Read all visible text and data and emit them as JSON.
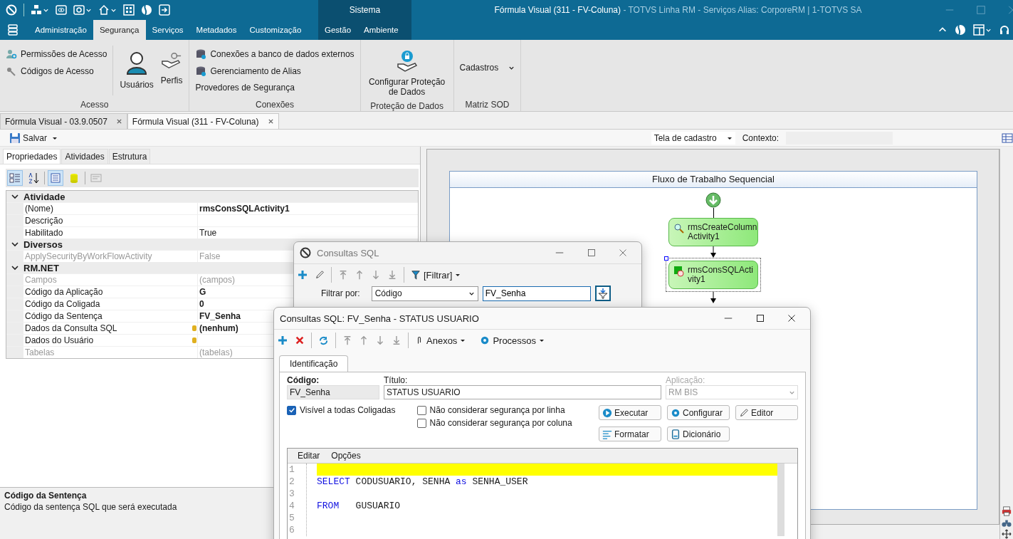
{
  "title_bar": {
    "section": "Sistema",
    "document": "Fórmula Visual (311 - FV-Coluna)",
    "details": "- TOTVS Linha RM - Serviços  Alias: CorporeRM | 1-TOTVS SA"
  },
  "ribbon_tabs": [
    {
      "label": "Administração",
      "selected": false,
      "contextual": false
    },
    {
      "label": "Segurança",
      "selected": true,
      "contextual": false
    },
    {
      "label": "Serviços",
      "selected": false,
      "contextual": false
    },
    {
      "label": "Metadados",
      "selected": false,
      "contextual": false
    },
    {
      "label": "Customização",
      "selected": false,
      "contextual": false
    },
    {
      "label": "Gestão",
      "selected": false,
      "contextual": true
    },
    {
      "label": "Ambiente",
      "selected": false,
      "contextual": true
    }
  ],
  "ribbon_groups": [
    {
      "label": "Acesso",
      "items": [
        {
          "kind": "small",
          "label": "Permissões de Acesso"
        },
        {
          "kind": "small",
          "label": "Códigos de Acesso"
        },
        {
          "kind": "large",
          "label": "Usuários"
        },
        {
          "kind": "large",
          "label": "Perfis"
        }
      ]
    },
    {
      "label": "Conexões",
      "items": [
        {
          "kind": "small",
          "label": "Conexões a banco de dados externos"
        },
        {
          "kind": "small",
          "label": "Gerenciamento de Alias"
        },
        {
          "kind": "text",
          "label": "Provedores de Segurança"
        }
      ]
    },
    {
      "label": "Proteção de Dados",
      "items": [
        {
          "kind": "large",
          "label": "Configurar Proteção de Dados"
        }
      ]
    },
    {
      "label": "Matriz SOD",
      "items": [
        {
          "kind": "dropdown",
          "label": "Cadastros"
        }
      ]
    }
  ],
  "document_tabs": [
    {
      "label": "Fórmula Visual - 03.9.0507",
      "selected": false
    },
    {
      "label": "Fórmula Visual (311 - FV-Coluna)",
      "selected": true
    }
  ],
  "toolbar": {
    "save": "Salvar",
    "view": "Tela de cadastro",
    "context_label": "Contexto:"
  },
  "panel_tabs": [
    {
      "label": "Propriedades",
      "selected": true
    },
    {
      "label": "Atividades",
      "selected": false
    },
    {
      "label": "Estrutura",
      "selected": false
    }
  ],
  "grid_tools": [
    {
      "kind": "categorized",
      "pressed": true
    },
    {
      "kind": "alphabetical",
      "pressed": false
    },
    {
      "kind": "properties",
      "pressed": true
    },
    {
      "kind": "events",
      "pressed": false
    },
    {
      "kind": "pages",
      "pressed": false
    }
  ],
  "property_grid": [
    {
      "name": "Atividade",
      "expanded": true,
      "rows": [
        {
          "name": "(Nome)",
          "value": "rmsConsSQLActivity1",
          "bold": true,
          "readonly": false,
          "editor": false
        },
        {
          "name": "Descrição",
          "readonly": false,
          "editor": false
        },
        {
          "name": "Habilitado",
          "value": "True",
          "bold": false,
          "readonly": false,
          "editor": false
        }
      ]
    },
    {
      "name": "Diversos",
      "expanded": true,
      "rows": [
        {
          "name": "ApplySecurityByWorkFlowActivity",
          "value": "False",
          "bold": false,
          "readonly": true,
          "editor": false
        }
      ]
    },
    {
      "name": "RM.NET",
      "expanded": true,
      "rows": [
        {
          "name": "Campos",
          "value": "(campos)",
          "bold": false,
          "readonly": true,
          "editor": false
        },
        {
          "name": "Código da Aplicação",
          "value": "G",
          "bold": true,
          "readonly": false,
          "editor": false
        },
        {
          "name": "Código da Coligada",
          "value": "0",
          "bold": true,
          "readonly": false,
          "editor": false
        },
        {
          "name": "Código da Sentença",
          "value": "FV_Senha",
          "bold": true,
          "readonly": false,
          "editor": false
        },
        {
          "name": "Dados da Consulta SQL",
          "value": "(nenhum)",
          "bold": true,
          "readonly": false,
          "editor": true
        },
        {
          "name": "Dados do Usuário",
          "readonly": false,
          "editor": true
        },
        {
          "name": "Tabelas",
          "value": "(tabelas)",
          "bold": false,
          "readonly": true,
          "editor": false
        }
      ]
    }
  ],
  "description": {
    "title": "Código da Sentença",
    "text": "Código da sentença SQL que será executada"
  },
  "workflow": {
    "title": "Fluxo de Trabalho Sequencial",
    "activities": [
      {
        "name": "rmsCreateColumnActivity1",
        "selected": false
      },
      {
        "name": "rmsConsSQLActivity1",
        "selected": true
      }
    ]
  },
  "search_dialog": {
    "title": "Consultas SQL",
    "filter_button": "[Filtrar]",
    "filter_label": "Filtrar por:",
    "filter_field": "Código",
    "filter_value": "FV_Senha"
  },
  "edit_dialog": {
    "title": "Consultas SQL: FV_Senha - STATUS USUARIO",
    "attachments": "Anexos",
    "processes": "Processos",
    "tabs": [
      {
        "label": "Identificação",
        "selected": true
      }
    ],
    "code_label": "Código:",
    "code_value": "FV_Senha",
    "title_label": "Título:",
    "title_value": "STATUS USUARIO",
    "app_label": "Aplicação:",
    "app_value": "RM BIS",
    "app_disabled": true,
    "option_columns": [
      [
        {
          "label": "Visível a todas Coligadas",
          "checked": true
        }
      ],
      [
        {
          "label": "Não considerar segurança por linha",
          "checked": false
        },
        {
          "label": "Não considerar segurança por coluna",
          "checked": false
        }
      ]
    ],
    "buttons": [
      {
        "kind": "run",
        "label": "Executar"
      },
      {
        "kind": "configure",
        "label": "Configurar"
      },
      {
        "kind": "edit",
        "label": "Editor"
      },
      {
        "kind": "format",
        "label": "Formatar"
      },
      {
        "kind": "dictionary",
        "label": "Dicionário"
      }
    ],
    "editor_menu": [
      "Editar",
      "Opções"
    ],
    "code_lines": [
      {
        "number": "1",
        "highlighted": true
      },
      {
        "number": "2",
        "highlighted": false,
        "tokens": [
          {
            "kind": "keyword",
            "text": "SELECT"
          },
          {
            "kind": "plain",
            "text": " CODUSUARIO, SENHA "
          },
          {
            "kind": "keyword",
            "text": "as"
          },
          {
            "kind": "plain",
            "text": " SENHA_USER"
          }
        ]
      },
      {
        "number": "3",
        "highlighted": false
      },
      {
        "number": "4",
        "highlighted": false,
        "tokens": [
          {
            "kind": "keyword",
            "text": "FROM"
          },
          {
            "kind": "plain",
            "text": "   GUSUARIO"
          }
        ]
      },
      {
        "number": "5",
        "highlighted": false
      },
      {
        "number": "6",
        "highlighted": false
      }
    ]
  }
}
